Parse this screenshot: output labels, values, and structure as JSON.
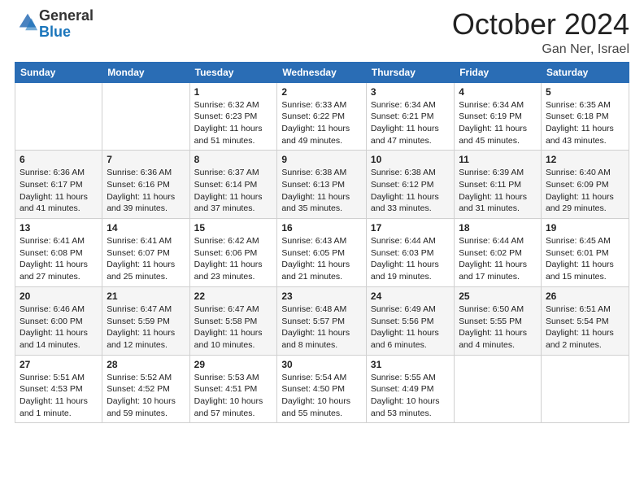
{
  "header": {
    "logo_general": "General",
    "logo_blue": "Blue",
    "month": "October 2024",
    "location": "Gan Ner, Israel"
  },
  "days_of_week": [
    "Sunday",
    "Monday",
    "Tuesday",
    "Wednesday",
    "Thursday",
    "Friday",
    "Saturday"
  ],
  "weeks": [
    [
      {
        "day": "",
        "sunrise": "",
        "sunset": "",
        "daylight": ""
      },
      {
        "day": "",
        "sunrise": "",
        "sunset": "",
        "daylight": ""
      },
      {
        "day": "1",
        "sunrise": "Sunrise: 6:32 AM",
        "sunset": "Sunset: 6:23 PM",
        "daylight": "Daylight: 11 hours and 51 minutes."
      },
      {
        "day": "2",
        "sunrise": "Sunrise: 6:33 AM",
        "sunset": "Sunset: 6:22 PM",
        "daylight": "Daylight: 11 hours and 49 minutes."
      },
      {
        "day": "3",
        "sunrise": "Sunrise: 6:34 AM",
        "sunset": "Sunset: 6:21 PM",
        "daylight": "Daylight: 11 hours and 47 minutes."
      },
      {
        "day": "4",
        "sunrise": "Sunrise: 6:34 AM",
        "sunset": "Sunset: 6:19 PM",
        "daylight": "Daylight: 11 hours and 45 minutes."
      },
      {
        "day": "5",
        "sunrise": "Sunrise: 6:35 AM",
        "sunset": "Sunset: 6:18 PM",
        "daylight": "Daylight: 11 hours and 43 minutes."
      }
    ],
    [
      {
        "day": "6",
        "sunrise": "Sunrise: 6:36 AM",
        "sunset": "Sunset: 6:17 PM",
        "daylight": "Daylight: 11 hours and 41 minutes."
      },
      {
        "day": "7",
        "sunrise": "Sunrise: 6:36 AM",
        "sunset": "Sunset: 6:16 PM",
        "daylight": "Daylight: 11 hours and 39 minutes."
      },
      {
        "day": "8",
        "sunrise": "Sunrise: 6:37 AM",
        "sunset": "Sunset: 6:14 PM",
        "daylight": "Daylight: 11 hours and 37 minutes."
      },
      {
        "day": "9",
        "sunrise": "Sunrise: 6:38 AM",
        "sunset": "Sunset: 6:13 PM",
        "daylight": "Daylight: 11 hours and 35 minutes."
      },
      {
        "day": "10",
        "sunrise": "Sunrise: 6:38 AM",
        "sunset": "Sunset: 6:12 PM",
        "daylight": "Daylight: 11 hours and 33 minutes."
      },
      {
        "day": "11",
        "sunrise": "Sunrise: 6:39 AM",
        "sunset": "Sunset: 6:11 PM",
        "daylight": "Daylight: 11 hours and 31 minutes."
      },
      {
        "day": "12",
        "sunrise": "Sunrise: 6:40 AM",
        "sunset": "Sunset: 6:09 PM",
        "daylight": "Daylight: 11 hours and 29 minutes."
      }
    ],
    [
      {
        "day": "13",
        "sunrise": "Sunrise: 6:41 AM",
        "sunset": "Sunset: 6:08 PM",
        "daylight": "Daylight: 11 hours and 27 minutes."
      },
      {
        "day": "14",
        "sunrise": "Sunrise: 6:41 AM",
        "sunset": "Sunset: 6:07 PM",
        "daylight": "Daylight: 11 hours and 25 minutes."
      },
      {
        "day": "15",
        "sunrise": "Sunrise: 6:42 AM",
        "sunset": "Sunset: 6:06 PM",
        "daylight": "Daylight: 11 hours and 23 minutes."
      },
      {
        "day": "16",
        "sunrise": "Sunrise: 6:43 AM",
        "sunset": "Sunset: 6:05 PM",
        "daylight": "Daylight: 11 hours and 21 minutes."
      },
      {
        "day": "17",
        "sunrise": "Sunrise: 6:44 AM",
        "sunset": "Sunset: 6:03 PM",
        "daylight": "Daylight: 11 hours and 19 minutes."
      },
      {
        "day": "18",
        "sunrise": "Sunrise: 6:44 AM",
        "sunset": "Sunset: 6:02 PM",
        "daylight": "Daylight: 11 hours and 17 minutes."
      },
      {
        "day": "19",
        "sunrise": "Sunrise: 6:45 AM",
        "sunset": "Sunset: 6:01 PM",
        "daylight": "Daylight: 11 hours and 15 minutes."
      }
    ],
    [
      {
        "day": "20",
        "sunrise": "Sunrise: 6:46 AM",
        "sunset": "Sunset: 6:00 PM",
        "daylight": "Daylight: 11 hours and 14 minutes."
      },
      {
        "day": "21",
        "sunrise": "Sunrise: 6:47 AM",
        "sunset": "Sunset: 5:59 PM",
        "daylight": "Daylight: 11 hours and 12 minutes."
      },
      {
        "day": "22",
        "sunrise": "Sunrise: 6:47 AM",
        "sunset": "Sunset: 5:58 PM",
        "daylight": "Daylight: 11 hours and 10 minutes."
      },
      {
        "day": "23",
        "sunrise": "Sunrise: 6:48 AM",
        "sunset": "Sunset: 5:57 PM",
        "daylight": "Daylight: 11 hours and 8 minutes."
      },
      {
        "day": "24",
        "sunrise": "Sunrise: 6:49 AM",
        "sunset": "Sunset: 5:56 PM",
        "daylight": "Daylight: 11 hours and 6 minutes."
      },
      {
        "day": "25",
        "sunrise": "Sunrise: 6:50 AM",
        "sunset": "Sunset: 5:55 PM",
        "daylight": "Daylight: 11 hours and 4 minutes."
      },
      {
        "day": "26",
        "sunrise": "Sunrise: 6:51 AM",
        "sunset": "Sunset: 5:54 PM",
        "daylight": "Daylight: 11 hours and 2 minutes."
      }
    ],
    [
      {
        "day": "27",
        "sunrise": "Sunrise: 5:51 AM",
        "sunset": "Sunset: 4:53 PM",
        "daylight": "Daylight: 11 hours and 1 minute."
      },
      {
        "day": "28",
        "sunrise": "Sunrise: 5:52 AM",
        "sunset": "Sunset: 4:52 PM",
        "daylight": "Daylight: 10 hours and 59 minutes."
      },
      {
        "day": "29",
        "sunrise": "Sunrise: 5:53 AM",
        "sunset": "Sunset: 4:51 PM",
        "daylight": "Daylight: 10 hours and 57 minutes."
      },
      {
        "day": "30",
        "sunrise": "Sunrise: 5:54 AM",
        "sunset": "Sunset: 4:50 PM",
        "daylight": "Daylight: 10 hours and 55 minutes."
      },
      {
        "day": "31",
        "sunrise": "Sunrise: 5:55 AM",
        "sunset": "Sunset: 4:49 PM",
        "daylight": "Daylight: 10 hours and 53 minutes."
      },
      {
        "day": "",
        "sunrise": "",
        "sunset": "",
        "daylight": ""
      },
      {
        "day": "",
        "sunrise": "",
        "sunset": "",
        "daylight": ""
      }
    ]
  ]
}
